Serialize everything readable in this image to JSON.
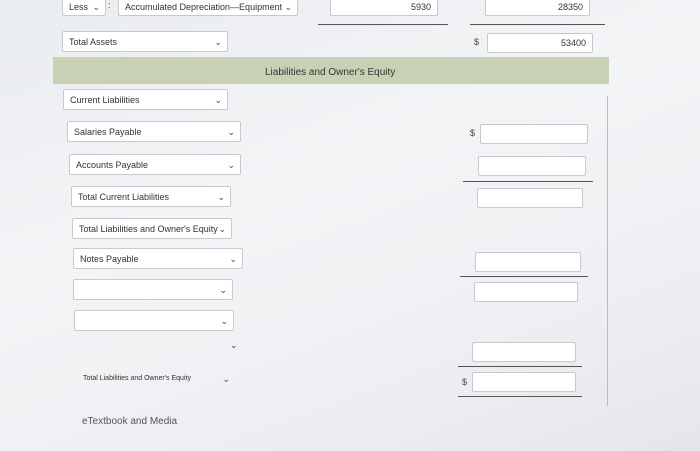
{
  "top_row": {
    "less_select": "Less",
    "less_sep": ":",
    "account_select": "Accumulated Depreciation—Equipment",
    "amount1": "5930",
    "amount2": "28350"
  },
  "total_assets": {
    "label": "Total Assets",
    "currency": "$",
    "value": "53400"
  },
  "section_header": "Liabilities and Owner's Equity",
  "selects": [
    "Current Liabilities",
    "Salaries Payable",
    "Accounts Payable",
    "Total Current Liabilities",
    "Total Liabilities and Owner's Equity",
    "Notes Payable",
    "",
    "",
    "Total Liabilities and Owner's Equity"
  ],
  "currency_symbols": [
    "$",
    "$"
  ],
  "footer_link": "eTextbook and Media"
}
